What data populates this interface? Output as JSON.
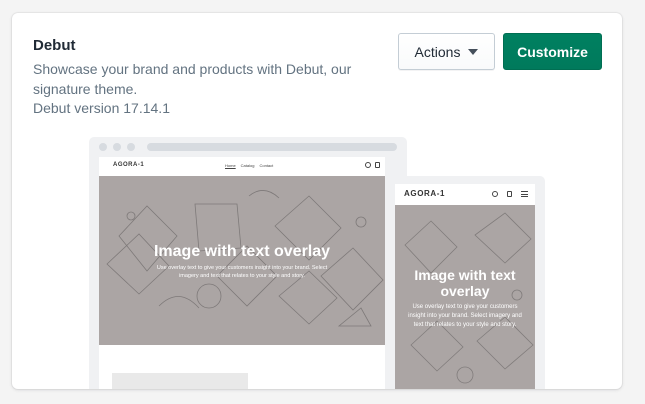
{
  "theme": {
    "name": "Debut",
    "description": "Showcase your brand and products with Debut, our signature theme.",
    "version": "Debut version 17.14.1"
  },
  "buttons": {
    "actions_label": "Actions",
    "customize_label": "Customize"
  },
  "preview": {
    "store_name": "AGORA-1",
    "nav": [
      "Home",
      "Catalog",
      "Contact"
    ],
    "hero_title": "Image with text overlay",
    "hero_subtitle": "Use overlay text to give your customers insight into your brand. Select imagery and text that relates to your style and story."
  },
  "colors": {
    "primary": "#008060",
    "hero_bg": "#aba5a4"
  }
}
